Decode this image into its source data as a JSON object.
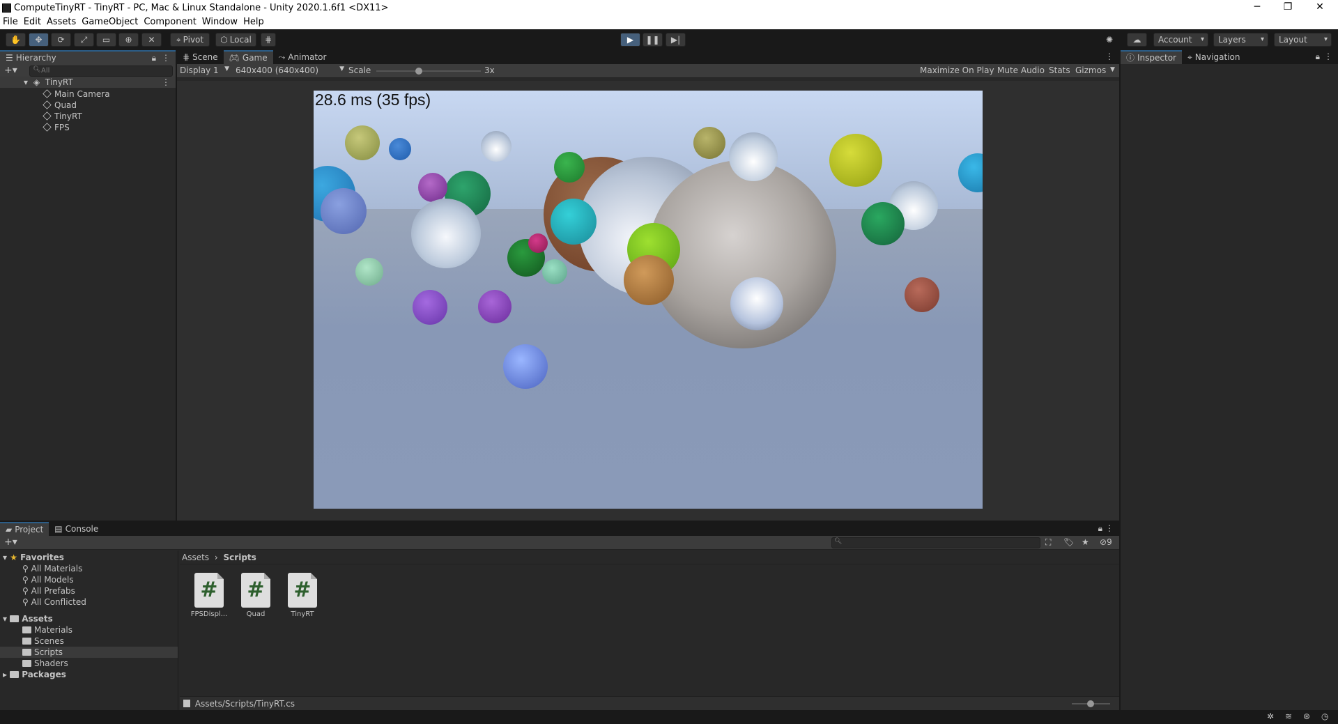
{
  "window": {
    "title": "ComputeTinyRT - TinyRT - PC, Mac & Linux Standalone - Unity 2020.1.6f1 <DX11>",
    "minimize": "─",
    "restore": "❐",
    "close": "✕"
  },
  "menu": [
    "File",
    "Edit",
    "Assets",
    "GameObject",
    "Component",
    "Window",
    "Help"
  ],
  "toolbar": {
    "pivot_label": "Pivot",
    "local_label": "Local",
    "account_label": "Account",
    "layers_label": "Layers",
    "layout_label": "Layout"
  },
  "hierarchy": {
    "tab_label": "Hierarchy",
    "search_placeholder": "All",
    "scene": "TinyRT",
    "objects": [
      "Main Camera",
      "Quad",
      "TinyRT",
      "FPS"
    ]
  },
  "game_view": {
    "tabs": [
      "Scene",
      "Game",
      "Animator"
    ],
    "selected_tab": "Game",
    "display": "Display 1",
    "resolution": "640x400 (640x400)",
    "scale_label": "Scale",
    "scale_value": "3x",
    "scale_fraction": 0.4,
    "maximize_on_play": "Maximize On Play",
    "mute_audio": "Mute Audio",
    "stats": "Stats",
    "gizmos": "Gizmos",
    "fps_text": "28.6 ms (35 fps)"
  },
  "right_panel": {
    "inspector": "Inspector",
    "navigation": "Navigation"
  },
  "project": {
    "tabs": [
      "Project",
      "Console"
    ],
    "hidden_count": "9",
    "favorites_label": "Favorites",
    "favorites": [
      "All Materials",
      "All Models",
      "All Prefabs",
      "All Conflicted"
    ],
    "assets_label": "Assets",
    "asset_folders": [
      "Materials",
      "Scenes",
      "Scripts",
      "Shaders"
    ],
    "selected_folder": "Scripts",
    "packages_label": "Packages",
    "breadcrumb": [
      "Assets",
      "Scripts"
    ],
    "files": [
      {
        "name": "FPSDispl...",
        "icon": "#"
      },
      {
        "name": "Quad",
        "icon": "#"
      },
      {
        "name": "TinyRT",
        "icon": "#"
      }
    ],
    "footer_path": "Assets/Scripts/TinyRT.cs"
  }
}
